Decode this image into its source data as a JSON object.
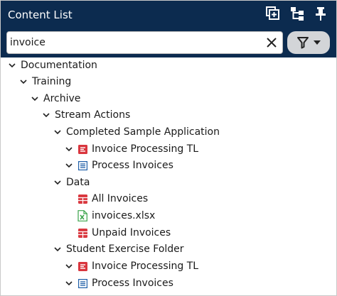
{
  "header": {
    "title": "Content List",
    "icons": [
      "add-to-collection-icon",
      "hierarchy-icon",
      "pin-icon"
    ]
  },
  "search": {
    "value": "invoice",
    "clear_icon": "close-icon",
    "filter_icon": "filter-icon",
    "dropdown_icon": "caret-down-icon"
  },
  "colors": {
    "header_bg": "#0c2b4f",
    "report_icon": "#d9363e",
    "process_icon": "#1f5fa8",
    "excel_icon": "#3aa34a"
  },
  "tree": [
    {
      "label": "Documentation",
      "type": "folder",
      "expanded": true
    },
    {
      "label": "Training",
      "type": "folder",
      "expanded": true
    },
    {
      "label": "Archive",
      "type": "folder",
      "expanded": true
    },
    {
      "label": "Stream Actions",
      "type": "folder",
      "expanded": true
    },
    {
      "label": "Completed Sample Application",
      "type": "folder",
      "expanded": true
    },
    {
      "label": "Invoice Processing TL",
      "type": "transformation",
      "expanded": true
    },
    {
      "label": "Process Invoices",
      "type": "process",
      "expanded": true
    },
    {
      "label": "Data",
      "type": "folder",
      "expanded": true
    },
    {
      "label": "All Invoices",
      "type": "report"
    },
    {
      "label": "invoices.xlsx",
      "type": "excel"
    },
    {
      "label": "Unpaid Invoices",
      "type": "report"
    },
    {
      "label": "Student Exercise Folder",
      "type": "folder",
      "expanded": true
    },
    {
      "label": "Invoice Processing TL",
      "type": "transformation",
      "expanded": true
    },
    {
      "label": "Process Invoices",
      "type": "process",
      "expanded": true
    }
  ]
}
